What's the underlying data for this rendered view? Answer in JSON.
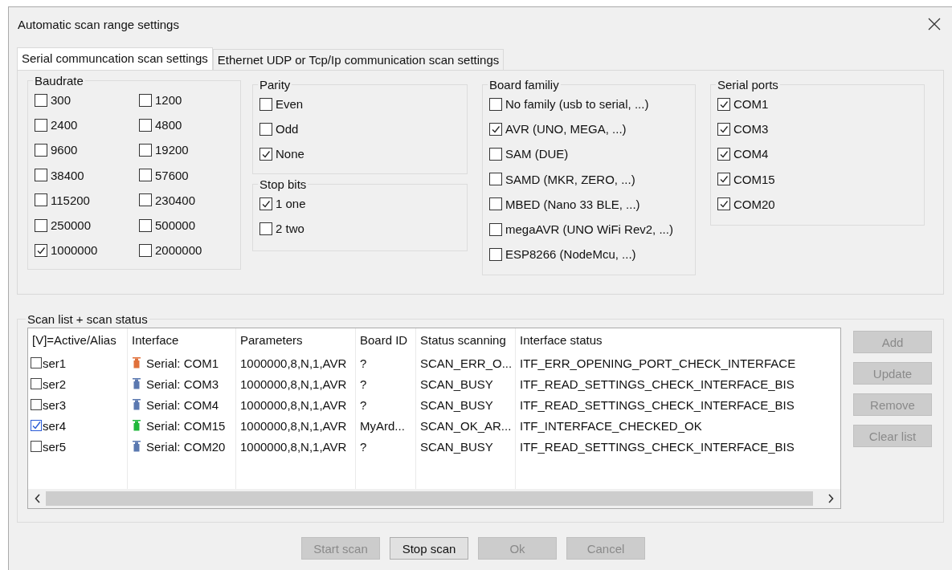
{
  "window": {
    "title": "Automatic scan range settings"
  },
  "tabs": [
    {
      "label": "Serial communcation scan settings",
      "selected": true
    },
    {
      "label": "Ethernet UDP or Tcp/Ip communication scan settings",
      "selected": false
    }
  ],
  "baudrate": {
    "title": "Baudrate",
    "options": [
      {
        "label": "300",
        "checked": false
      },
      {
        "label": "1200",
        "checked": false
      },
      {
        "label": "2400",
        "checked": false
      },
      {
        "label": "4800",
        "checked": false
      },
      {
        "label": "9600",
        "checked": false
      },
      {
        "label": "19200",
        "checked": false
      },
      {
        "label": "38400",
        "checked": false
      },
      {
        "label": "57600",
        "checked": false
      },
      {
        "label": "115200",
        "checked": false
      },
      {
        "label": "230400",
        "checked": false
      },
      {
        "label": "250000",
        "checked": false
      },
      {
        "label": "500000",
        "checked": false
      },
      {
        "label": "1000000",
        "checked": true
      },
      {
        "label": "2000000",
        "checked": false
      }
    ]
  },
  "parity": {
    "title": "Parity",
    "options": [
      {
        "label": "Even",
        "checked": false
      },
      {
        "label": "Odd",
        "checked": false
      },
      {
        "label": "None",
        "checked": true
      }
    ]
  },
  "stop_bits": {
    "title": "Stop bits",
    "options": [
      {
        "label": "1 one",
        "checked": true
      },
      {
        "label": "2 two",
        "checked": false
      }
    ]
  },
  "board_family": {
    "title": "Board familiy",
    "options": [
      {
        "label": "No family (usb to serial, ...)",
        "checked": false
      },
      {
        "label": "AVR (UNO, MEGA, ...)",
        "checked": true
      },
      {
        "label": "SAM (DUE)",
        "checked": false
      },
      {
        "label": "SAMD (MKR, ZERO, ...)",
        "checked": false
      },
      {
        "label": "MBED (Nano 33 BLE, ...)",
        "checked": false
      },
      {
        "label": "megaAVR (UNO WiFi Rev2, ...)",
        "checked": false
      },
      {
        "label": "ESP8266 (NodeMcu, ...)",
        "checked": false
      }
    ]
  },
  "serial_ports": {
    "title": "Serial ports",
    "options": [
      {
        "label": "COM1",
        "checked": true
      },
      {
        "label": "COM3",
        "checked": true
      },
      {
        "label": "COM4",
        "checked": true
      },
      {
        "label": "COM15",
        "checked": true
      },
      {
        "label": "COM20",
        "checked": true
      }
    ]
  },
  "scan_list": {
    "title": "Scan list + scan status",
    "columns": [
      "[V]=Active/Alias",
      "Interface",
      "Parameters",
      "Board ID",
      "Status scanning",
      "Interface status"
    ],
    "rows": [
      {
        "alias": "ser1",
        "checked": false,
        "color": "#e0703a",
        "interface": "Serial:  COM1",
        "parameters": "1000000,8,N,1,AVR",
        "board_id": "?",
        "status_scanning": "SCAN_ERR_O...",
        "interface_status": "ITF_ERR_OPENING_PORT_CHECK_INTERFACE"
      },
      {
        "alias": "ser2",
        "checked": false,
        "color": "#5a78b0",
        "interface": "Serial:  COM3",
        "parameters": "1000000,8,N,1,AVR",
        "board_id": "?",
        "status_scanning": "SCAN_BUSY",
        "interface_status": "ITF_READ_SETTINGS_CHECK_INTERFACE_BIS"
      },
      {
        "alias": "ser3",
        "checked": false,
        "color": "#5a78b0",
        "interface": "Serial:  COM4",
        "parameters": "1000000,8,N,1,AVR",
        "board_id": "?",
        "status_scanning": "SCAN_BUSY",
        "interface_status": "ITF_READ_SETTINGS_CHECK_INTERFACE_BIS"
      },
      {
        "alias": "ser4",
        "checked": true,
        "color": "#1fb83a",
        "interface": "Serial:  COM15",
        "parameters": "1000000,8,N,1,AVR",
        "board_id": "MyArd...",
        "status_scanning": "SCAN_OK_AR...",
        "interface_status": "ITF_INTERFACE_CHECKED_OK"
      },
      {
        "alias": "ser5",
        "checked": false,
        "color": "#5a78b0",
        "interface": "Serial:  COM20",
        "parameters": "1000000,8,N,1,AVR",
        "board_id": "?",
        "status_scanning": "SCAN_BUSY",
        "interface_status": "ITF_READ_SETTINGS_CHECK_INTERFACE_BIS"
      }
    ]
  },
  "side_buttons": [
    {
      "label": "Add",
      "disabled": true
    },
    {
      "label": "Update",
      "disabled": true
    },
    {
      "label": "Remove",
      "disabled": true
    },
    {
      "label": "Clear list",
      "disabled": true
    }
  ],
  "bottom_buttons": [
    {
      "label": "Start scan",
      "disabled": true
    },
    {
      "label": "Stop scan",
      "disabled": false
    },
    {
      "label": "Ok",
      "disabled": true
    },
    {
      "label": "Cancel",
      "disabled": true
    }
  ]
}
